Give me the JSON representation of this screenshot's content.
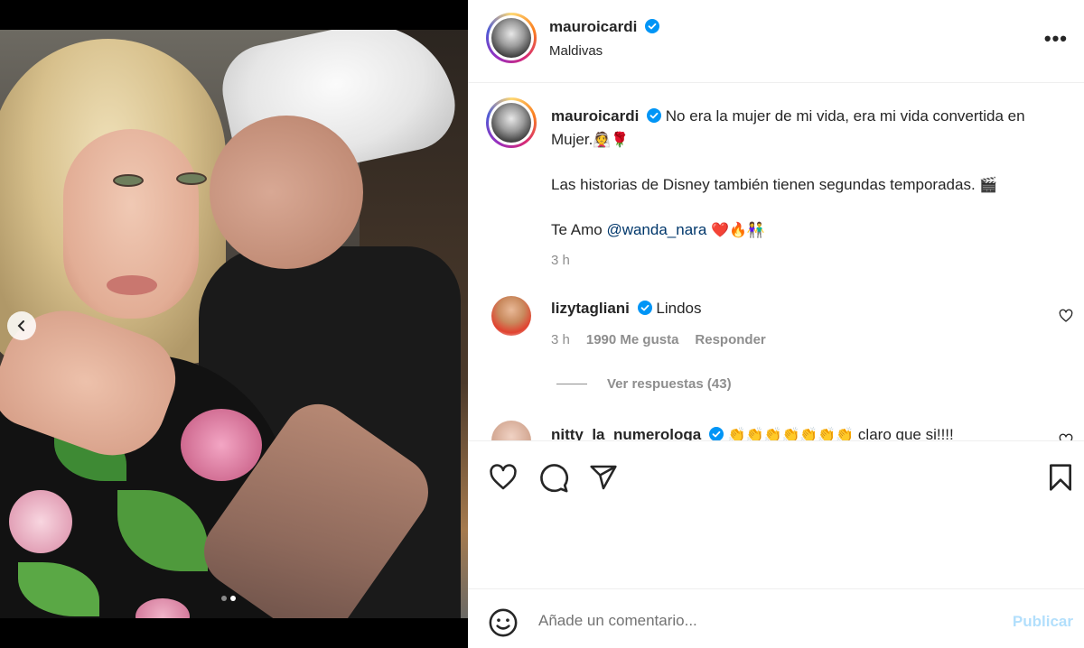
{
  "post": {
    "username": "mauroicardi",
    "location": "Maldivas",
    "carousel": {
      "slide_count": 2,
      "active_slide": 2
    }
  },
  "caption": {
    "username": "mauroicardi",
    "line1": "No era la mujer de mi vida, era mi vida convertida en Mujer.",
    "line1_emoji": "👰🌹",
    "line2": "Las historias de Disney también tienen segundas temporadas.",
    "line2_emoji": "🎬",
    "line3_prefix": "Te Amo",
    "mention": "@wanda_nara",
    "line3_emoji": "❤️🔥👫",
    "time": "3 h"
  },
  "comments": [
    {
      "username": "lizytagliani",
      "text": "Lindos",
      "time": "3 h",
      "likes": "1990 Me gusta",
      "reply_label": "Responder",
      "view_replies": "Ver respuestas (43)"
    },
    {
      "username": "nitty_la_numerologa",
      "emoji": "👏👏👏👏👏👏👏",
      "text": "claro que si!!!!"
    }
  ],
  "add_comment": {
    "placeholder": "Añade un comentario...",
    "publish_label": "Publicar"
  },
  "colors": {
    "verified": "#0095f6",
    "publish_disabled": "#b2dffc",
    "muted_text": "#8e8e8e"
  }
}
